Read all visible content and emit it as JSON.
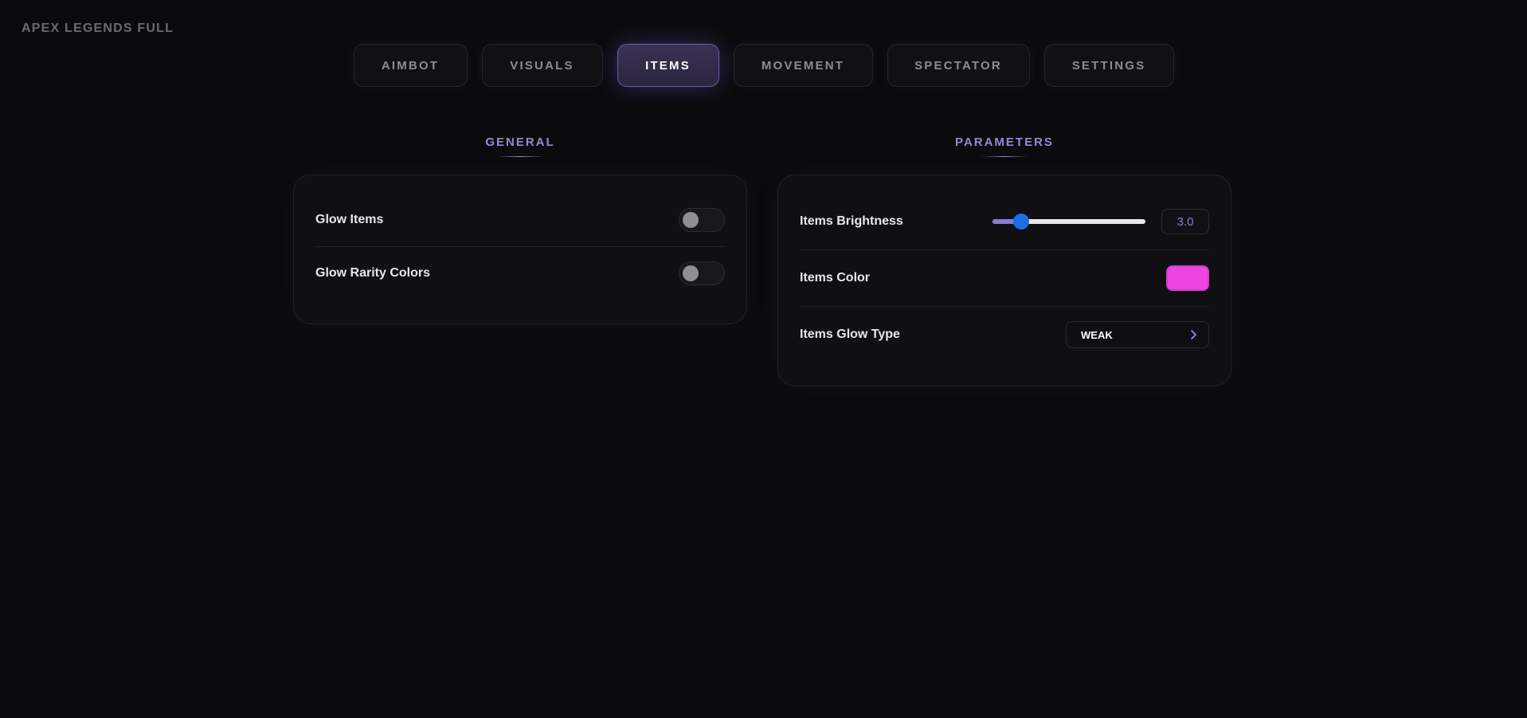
{
  "app_title": "APEX LEGENDS FULL",
  "tabs": [
    {
      "label": "AIMBOT",
      "active": false
    },
    {
      "label": "VISUALS",
      "active": false
    },
    {
      "label": "ITEMS",
      "active": true
    },
    {
      "label": "MOVEMENT",
      "active": false
    },
    {
      "label": "SPECTATOR",
      "active": false
    },
    {
      "label": "SETTINGS",
      "active": false
    }
  ],
  "general": {
    "heading": "GENERAL",
    "rows": [
      {
        "label": "Glow Items",
        "enabled": false
      },
      {
        "label": "Glow Rarity Colors",
        "enabled": false
      }
    ]
  },
  "parameters": {
    "heading": "PARAMETERS",
    "brightness": {
      "label": "Items Brightness",
      "value": "3.0",
      "fraction": 0.19
    },
    "color": {
      "label": "Items Color",
      "hex": "#ee44e0"
    },
    "glow_type": {
      "label": "Items Glow Type",
      "value": "WEAK",
      "icon": "chevron-right-icon"
    }
  },
  "colors": {
    "accent": "#9a86d6",
    "slider_thumb": "#1a6fe8",
    "background": "#0b0b0d"
  }
}
